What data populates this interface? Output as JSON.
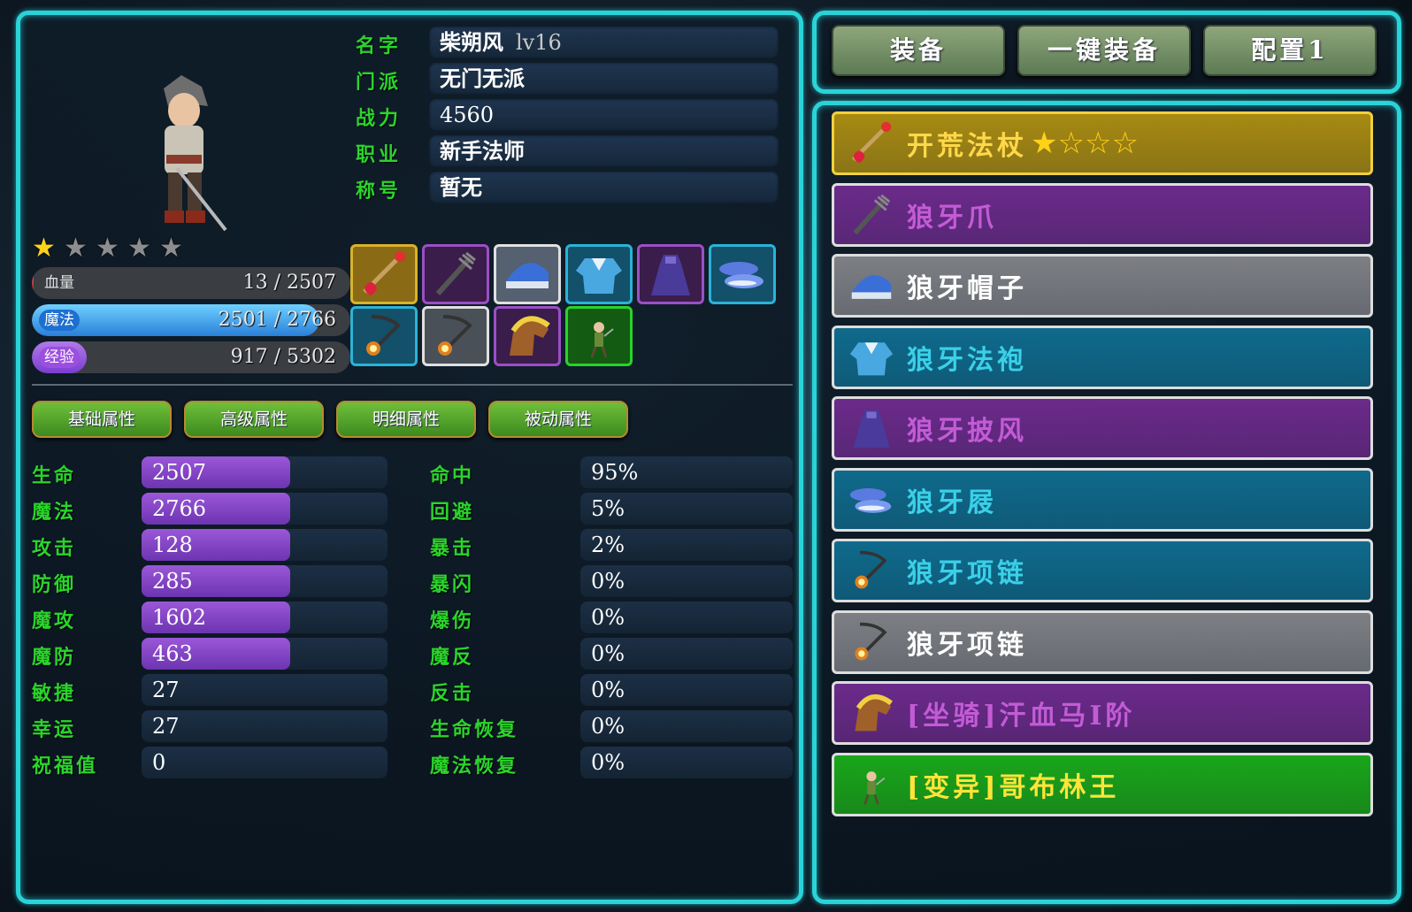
{
  "character": {
    "name": "柴朔风",
    "level": "lv16",
    "faction": "无门无派",
    "power": "4560",
    "job": "新手法师",
    "title": "暂无",
    "stars_total": 5,
    "stars_lit": 1
  },
  "info_labels": {
    "name": "名字",
    "faction": "门派",
    "power": "战力",
    "job": "职业",
    "title": "称号"
  },
  "bars": {
    "hp": {
      "label": "血量",
      "value": "13 / 2507",
      "fraction": 0.005
    },
    "mp": {
      "label": "魔法",
      "value": "2501 / 2766",
      "fraction": 0.904
    },
    "exp": {
      "label": "经验",
      "value": "917 / 5302",
      "fraction": 0.173
    }
  },
  "tabs": [
    "基础属性",
    "高级属性",
    "明细属性",
    "被动属性"
  ],
  "stats_left": [
    {
      "label": "生命",
      "value": "2507",
      "bar": true
    },
    {
      "label": "魔法",
      "value": "2766",
      "bar": true
    },
    {
      "label": "攻击",
      "value": "128",
      "bar": true
    },
    {
      "label": "防御",
      "value": "285",
      "bar": true
    },
    {
      "label": "魔攻",
      "value": "1602",
      "bar": true
    },
    {
      "label": "魔防",
      "value": "463",
      "bar": true
    },
    {
      "label": "敏捷",
      "value": "27",
      "bar": false
    },
    {
      "label": "幸运",
      "value": "27",
      "bar": false
    },
    {
      "label": "祝福值",
      "value": "0",
      "bar": false
    }
  ],
  "stats_right": [
    {
      "label": "命中",
      "value": "95%"
    },
    {
      "label": "回避",
      "value": "5%"
    },
    {
      "label": "暴击",
      "value": "2%"
    },
    {
      "label": "暴闪",
      "value": "0%"
    },
    {
      "label": "爆伤",
      "value": "0%"
    },
    {
      "label": "魔反",
      "value": "0%"
    },
    {
      "label": "反击",
      "value": "0%"
    },
    {
      "label": "生命恢复",
      "value": "0%"
    },
    {
      "label": "魔法恢复",
      "value": "0%"
    }
  ],
  "buttons": {
    "equip": "装备",
    "one_click_equip": "一键装备",
    "config": "配置1"
  },
  "equipment_list": [
    {
      "name": "开荒法杖",
      "stars_lit": 1,
      "stars_total": 4,
      "color": "#a88a12",
      "text_color": "#ffd84a",
      "icon": "staff-icon"
    },
    {
      "name": "狼牙爪",
      "color": "#6b2a8a",
      "text_color": "#c35bd6",
      "icon": "claw-icon"
    },
    {
      "name": "狼牙帽子",
      "color": "#7d7f84",
      "text_color": "#ffffff",
      "icon": "hat-icon"
    },
    {
      "name": "狼牙法袍",
      "color": "#0f6a8c",
      "text_color": "#3ad0e8",
      "icon": "robe-icon"
    },
    {
      "name": "狼牙披风",
      "color": "#6b2a8a",
      "text_color": "#c35bd6",
      "icon": "cloak-icon"
    },
    {
      "name": "狼牙屐",
      "color": "#0f6a8c",
      "text_color": "#3ad0e8",
      "icon": "shoes-icon"
    },
    {
      "name": "狼牙项链",
      "color": "#0f6a8c",
      "text_color": "#3ad0e8",
      "icon": "necklace-icon"
    },
    {
      "name": "狼牙项链",
      "color": "#7d7f84",
      "text_color": "#ffffff",
      "icon": "necklace-icon"
    },
    {
      "name": "[坐骑]汗血马Ⅰ阶",
      "color": "#6b2a8a",
      "text_color": "#c35bd6",
      "icon": "horse-icon"
    },
    {
      "name": "[变异]哥布林王",
      "color": "#1aa61a",
      "text_color": "#ffe43a",
      "icon": "goblin-icon"
    }
  ],
  "equipment_slots": [
    {
      "icon": "staff-icon",
      "border": "#d8b32a",
      "bg": "#8a6a14"
    },
    {
      "icon": "claw-icon",
      "border": "#9b4fc4",
      "bg": "#3a1d4a"
    },
    {
      "icon": "hat-icon",
      "border": "#e0e0e0",
      "bg": "#556070"
    },
    {
      "icon": "robe-icon",
      "border": "#2ab3d8",
      "bg": "#13506a"
    },
    {
      "icon": "cloak-icon",
      "border": "#9b4fc4",
      "bg": "#3a1d4a"
    },
    {
      "icon": "shoes-icon",
      "border": "#2ab3d8",
      "bg": "#13506a"
    },
    {
      "icon": "necklace-icon",
      "border": "#2ab3d8",
      "bg": "#13506a"
    },
    {
      "icon": "necklace-icon",
      "border": "#e0e0e0",
      "bg": "#4a5058"
    },
    {
      "icon": "horse-icon",
      "border": "#9b4fc4",
      "bg": "#3a1d4a"
    },
    {
      "icon": "goblin-icon",
      "border": "#2ad32a",
      "bg": "#135a13"
    }
  ]
}
